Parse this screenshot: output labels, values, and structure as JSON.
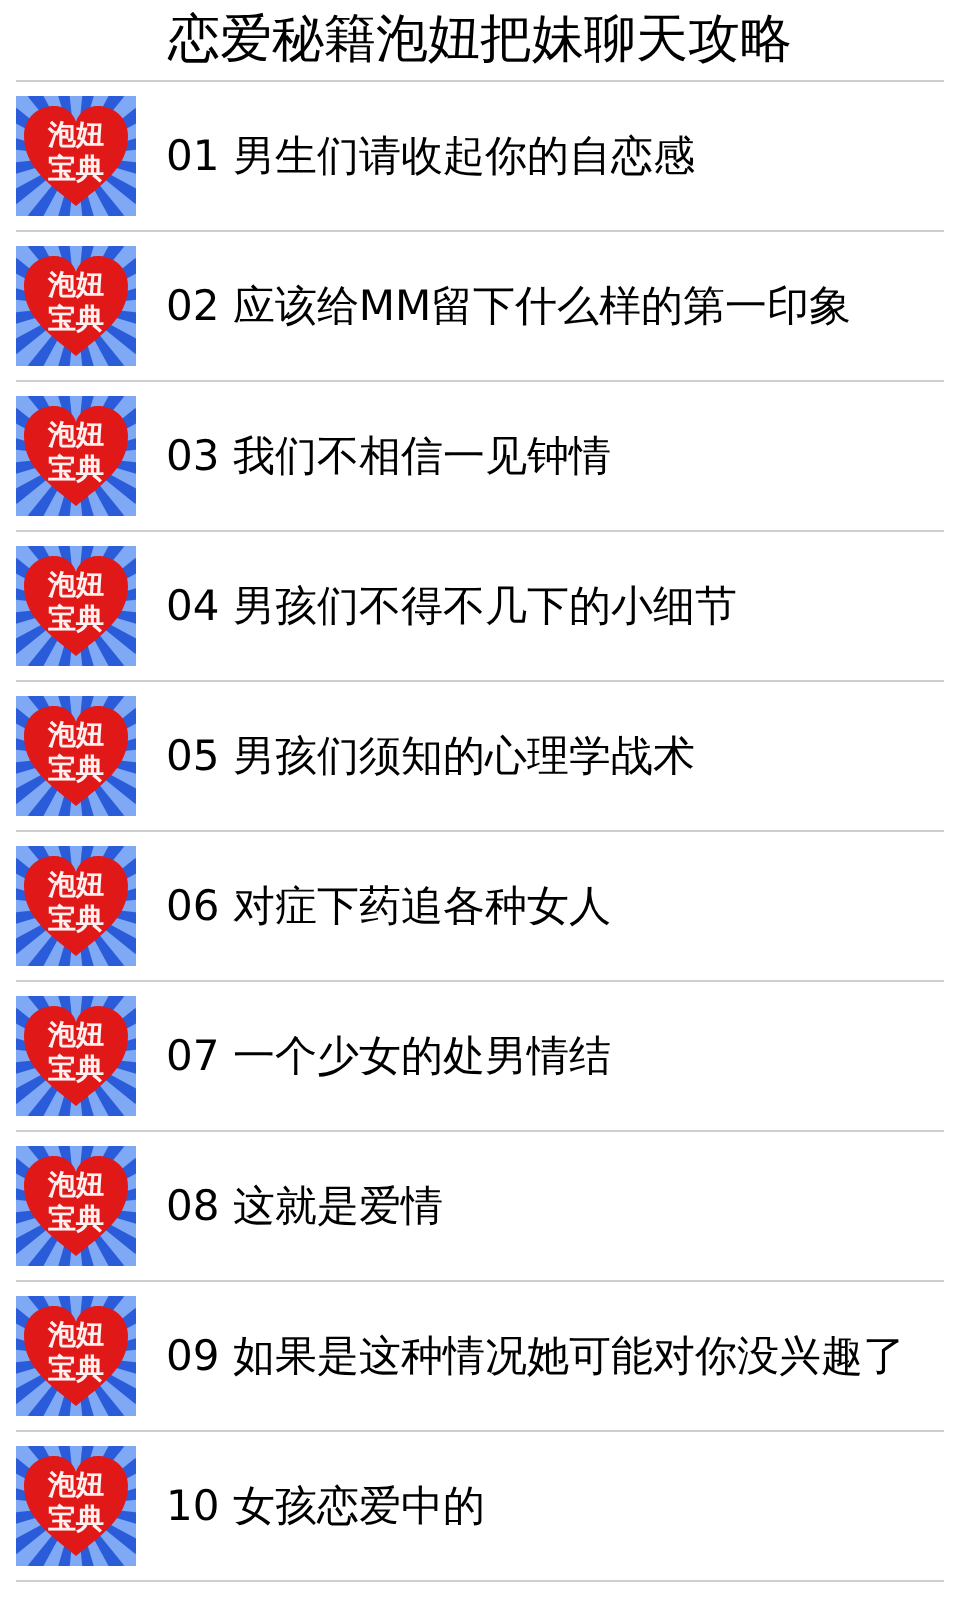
{
  "title": "恋爱秘籍泡妞把妹聊天攻略",
  "items": [
    {
      "label": "01 男生们请收起你的自恋感",
      "icon_text": [
        "泡妞",
        "宝典"
      ]
    },
    {
      "label": "02 应该给MM留下什么样的第一印象",
      "icon_text": [
        "泡妞",
        "宝典"
      ]
    },
    {
      "label": "03 我们不相信一见钟情",
      "icon_text": [
        "泡妞",
        "宝典"
      ]
    },
    {
      "label": "04 男孩们不得不几下的小细节",
      "icon_text": [
        "泡妞",
        "宝典"
      ]
    },
    {
      "label": "05 男孩们须知的心理学战术",
      "icon_text": [
        "泡妞",
        "宝典"
      ]
    },
    {
      "label": "06 对症下药追各种女人",
      "icon_text": [
        "泡妞",
        "宝典"
      ]
    },
    {
      "label": "07 一个少女的处男情结",
      "icon_text": [
        "泡妞",
        "宝典"
      ]
    },
    {
      "label": "08 这就是爱情",
      "icon_text": [
        "泡妞",
        "宝典"
      ]
    },
    {
      "label": "09 如果是这种情况她可能对你没兴趣了",
      "icon_text": [
        "泡妞",
        "宝典"
      ]
    },
    {
      "label": "10 女孩恋爱中的",
      "icon_text": [
        "泡妞",
        "宝典"
      ]
    }
  ]
}
